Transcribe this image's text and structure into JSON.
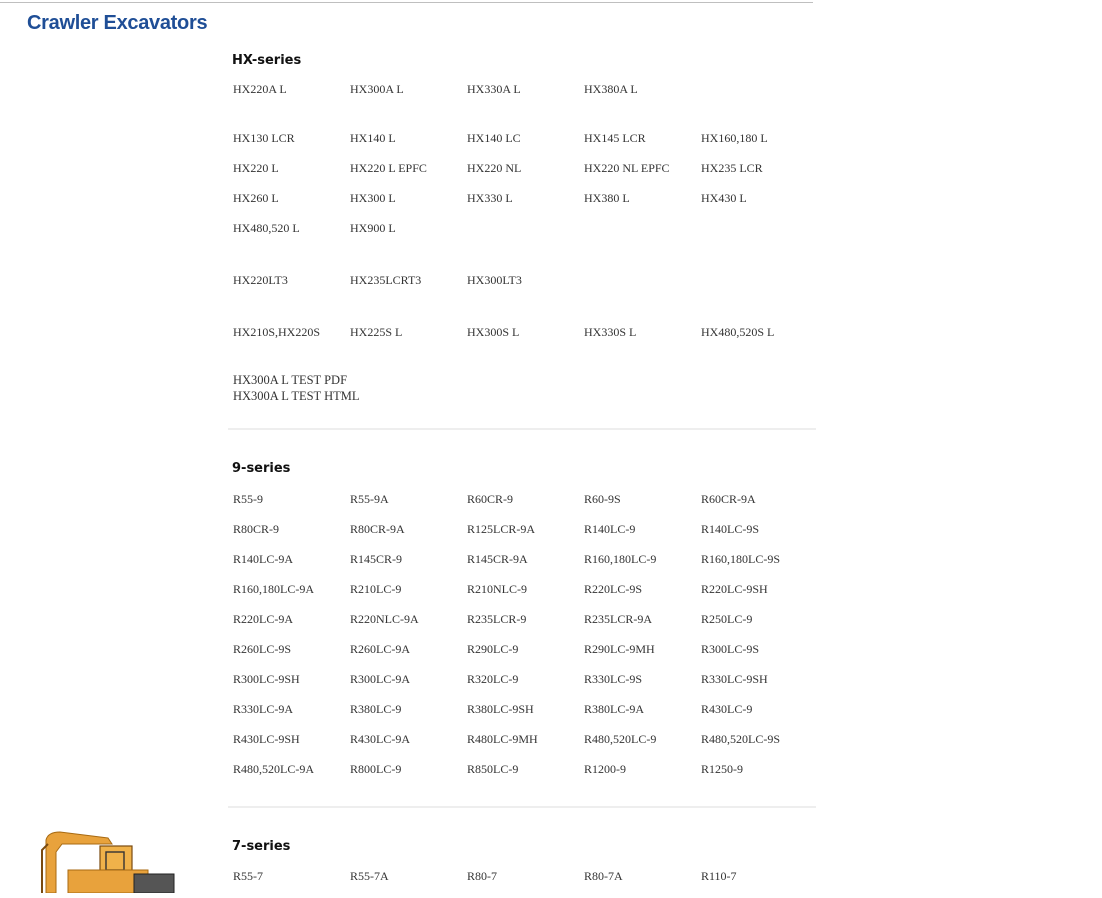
{
  "page_title": "Crawler Excavators",
  "sections": {
    "hx": {
      "title": "HX-series",
      "groups": [
        [
          [
            "HX220A L",
            "HX300A L",
            "HX330A L",
            "HX380A L"
          ]
        ],
        [
          [
            "HX130 LCR",
            "HX140 L",
            "HX140 LC",
            "HX145 LCR",
            "HX160,180 L"
          ],
          [
            "HX220 L",
            "HX220 L EPFC",
            "HX220 NL",
            "HX220 NL EPFC",
            "HX235 LCR"
          ],
          [
            "HX260 L",
            "HX300 L",
            "HX330 L",
            "HX380 L",
            "HX430 L"
          ],
          [
            "HX480,520 L",
            "HX900 L"
          ]
        ],
        [
          [
            "HX220LT3",
            "HX235LCRT3",
            "HX300LT3"
          ]
        ],
        [
          [
            "HX210S,HX220S",
            "HX225S L",
            "HX300S L",
            "HX330S L",
            "HX480,520S L"
          ]
        ]
      ],
      "test_links": [
        "HX300A L TEST PDF",
        "HX300A L TEST HTML"
      ]
    },
    "nine": {
      "title": "9-series",
      "rows": [
        [
          "R55-9",
          "R55-9A",
          "R60CR-9",
          "R60-9S",
          "R60CR-9A"
        ],
        [
          "R80CR-9",
          "R80CR-9A",
          "R125LCR-9A",
          "R140LC-9",
          "R140LC-9S"
        ],
        [
          "R140LC-9A",
          "R145CR-9",
          "R145CR-9A",
          "R160,180LC-9",
          "R160,180LC-9S"
        ],
        [
          "R160,180LC-9A",
          "R210LC-9",
          "R210NLC-9",
          "R220LC-9S",
          "R220LC-9SH"
        ],
        [
          "R220LC-9A",
          "R220NLC-9A",
          "R235LCR-9",
          "R235LCR-9A",
          "R250LC-9"
        ],
        [
          "R260LC-9S",
          "R260LC-9A",
          "R290LC-9",
          "R290LC-9MH",
          "R300LC-9S"
        ],
        [
          "R300LC-9SH",
          "R300LC-9A",
          "R320LC-9",
          "R330LC-9S",
          "R330LC-9SH"
        ],
        [
          "R330LC-9A",
          "R380LC-9",
          "R380LC-9SH",
          "R380LC-9A",
          "R430LC-9"
        ],
        [
          "R430LC-9SH",
          "R430LC-9A",
          "R480LC-9MH",
          "R480,520LC-9",
          "R480,520LC-9S"
        ],
        [
          "R480,520LC-9A",
          "R800LC-9",
          "R850LC-9",
          "R1200-9",
          "R1250-9"
        ]
      ]
    },
    "seven": {
      "title": "7-series",
      "rows": [
        [
          "R55-7",
          "R55-7A",
          "R80-7",
          "R80-7A",
          "R110-7"
        ]
      ]
    }
  },
  "image": {
    "icon": "excavator-icon",
    "color": "#e8a23c"
  }
}
